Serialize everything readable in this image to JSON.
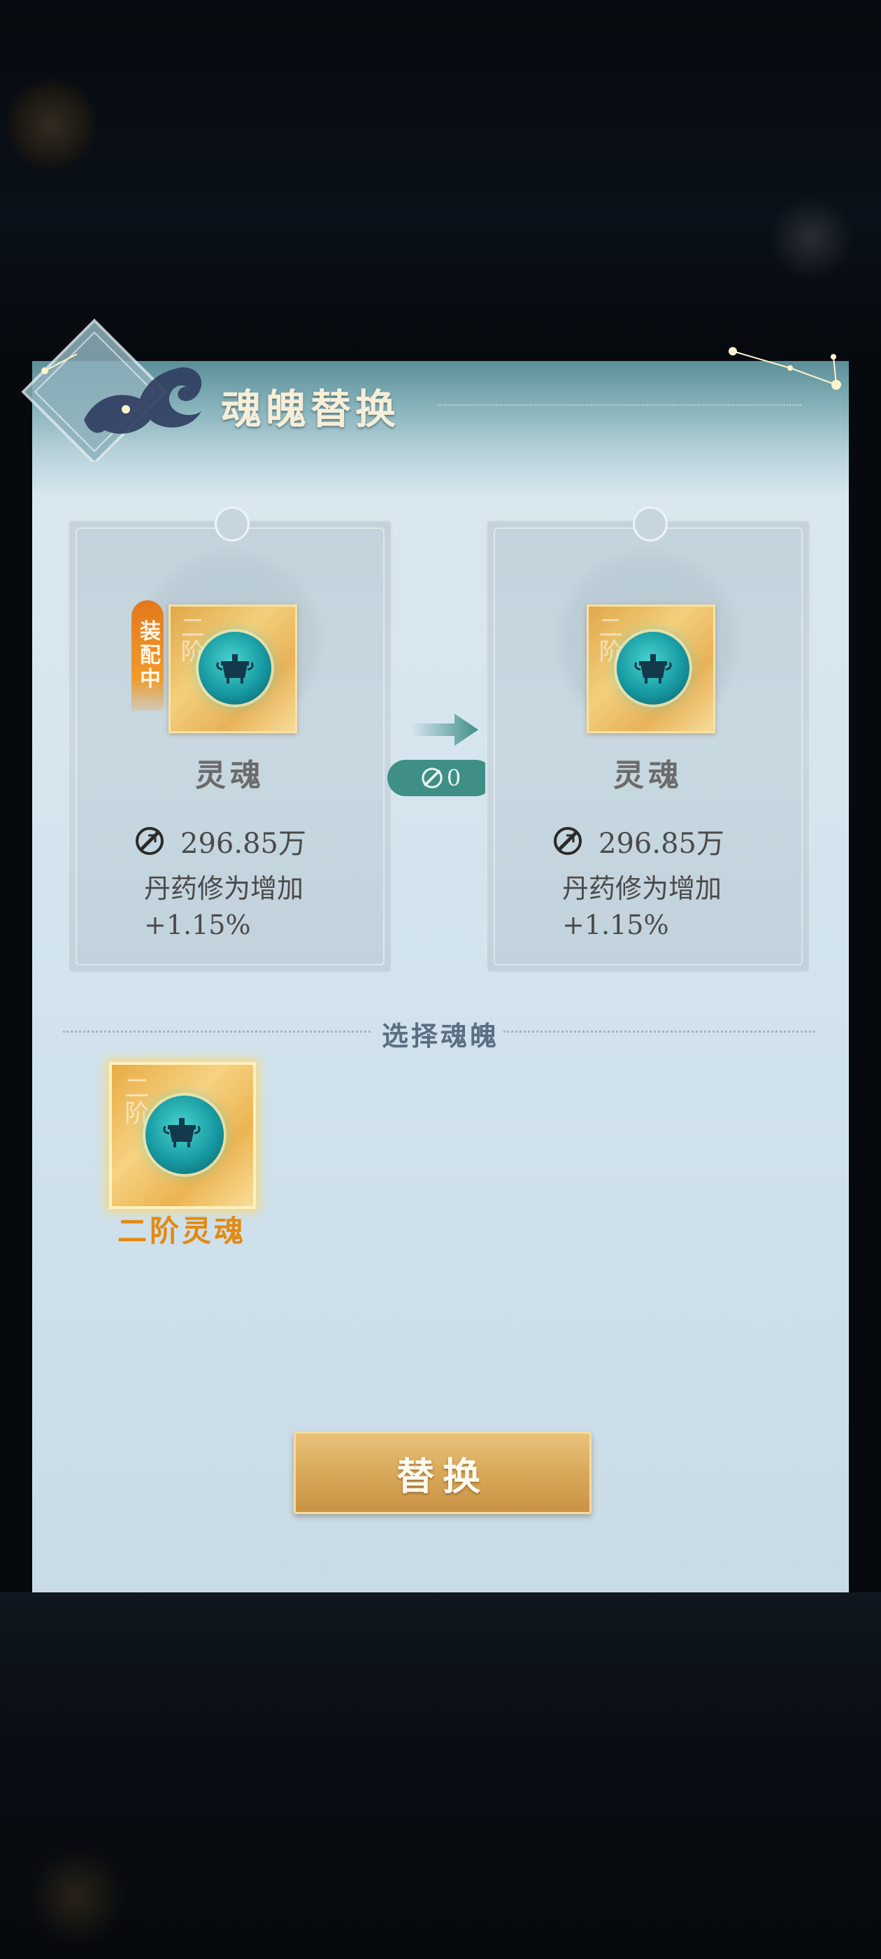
{
  "dialog": {
    "title": "魂魄替换"
  },
  "current_card": {
    "badge": "装配中",
    "tier_glyph": "二阶",
    "name": "灵魂",
    "power": "296.85万",
    "effect_label": "丹药修为增加",
    "effect_value": "+1.15%"
  },
  "change": {
    "delta": "0"
  },
  "new_card": {
    "tier_glyph": "二阶",
    "name": "灵魂",
    "power": "296.85万",
    "effect_label": "丹药修为增加",
    "effect_value": "+1.15%"
  },
  "select_section": {
    "title": "选择魂魄",
    "items": [
      {
        "tier_glyph": "二阶",
        "label": "二阶灵魂",
        "selected": true
      }
    ]
  },
  "actions": {
    "replace_label": "替换"
  },
  "colors": {
    "accent_gold": "#d9a95a",
    "selected_label": "#e28a12",
    "badge_orange": "#e4781c",
    "delta_teal": "#3f8f86"
  },
  "icons": {
    "power": "power-stat-icon",
    "arrow": "arrow-right-icon",
    "orb": "soul-orb-icon"
  }
}
